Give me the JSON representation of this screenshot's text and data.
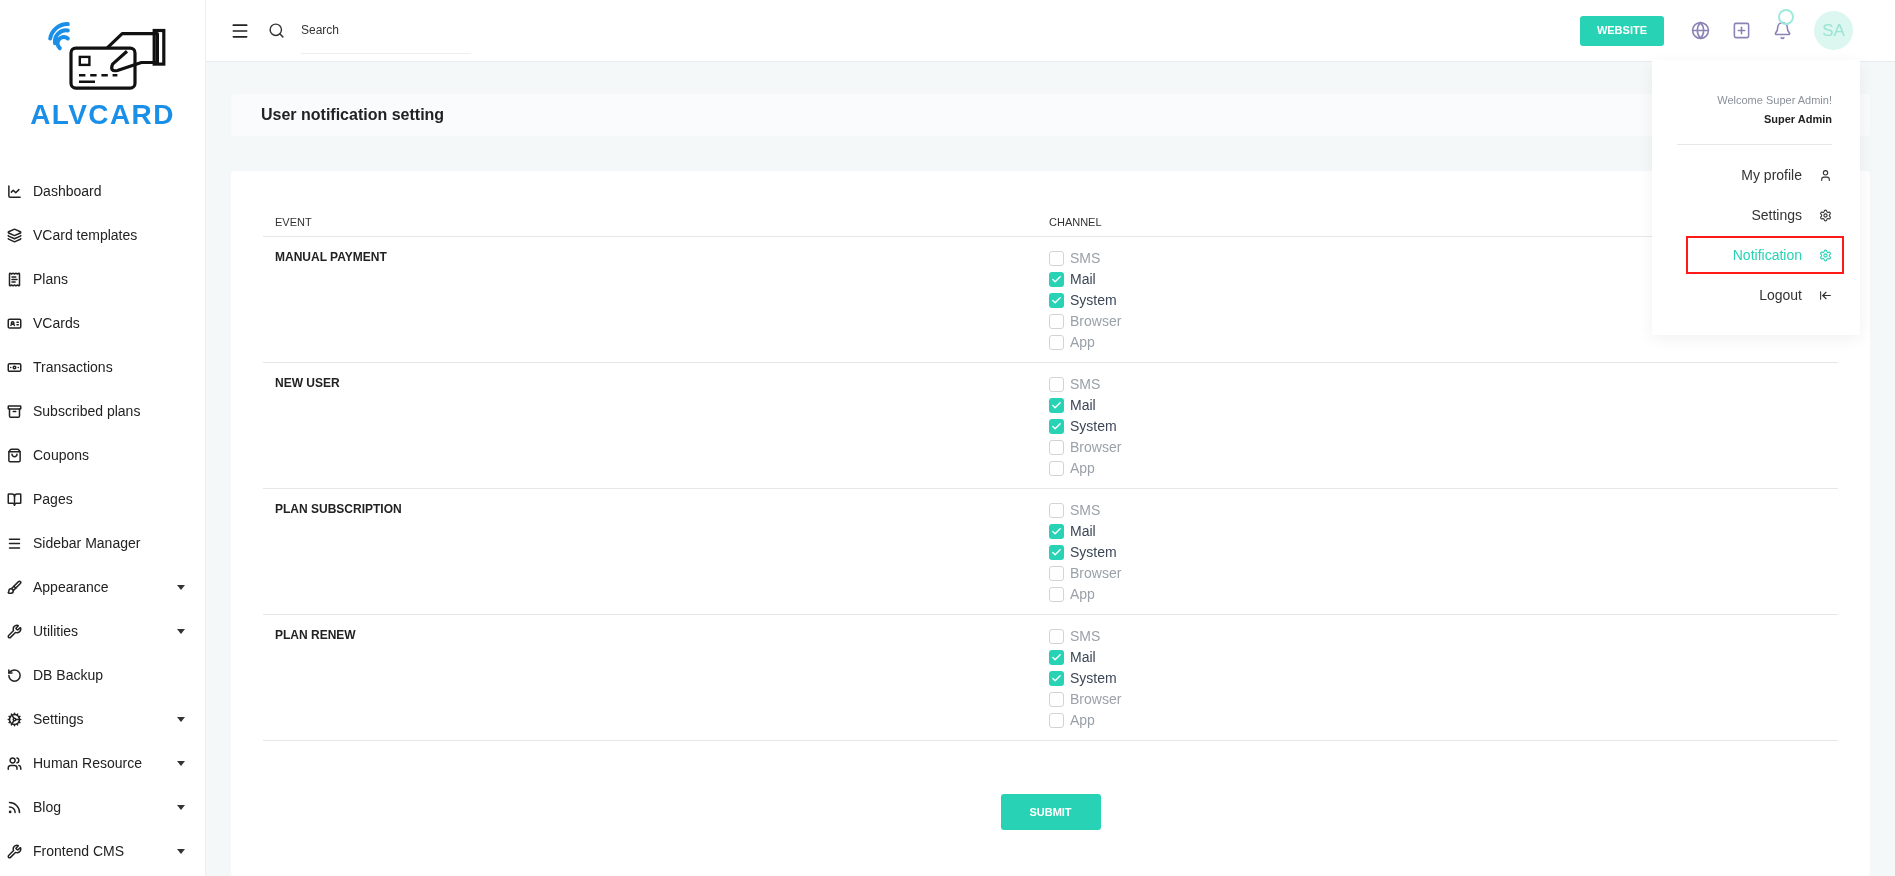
{
  "logo": {
    "text": "ALVCARD"
  },
  "sidebar": {
    "items": [
      {
        "label": "Dashboard",
        "expandable": false
      },
      {
        "label": "VCard templates",
        "expandable": false
      },
      {
        "label": "Plans",
        "expandable": false
      },
      {
        "label": "VCards",
        "expandable": false
      },
      {
        "label": "Transactions",
        "expandable": false
      },
      {
        "label": "Subscribed plans",
        "expandable": false
      },
      {
        "label": "Coupons",
        "expandable": false
      },
      {
        "label": "Pages",
        "expandable": false
      },
      {
        "label": "Sidebar Manager",
        "expandable": false
      },
      {
        "label": "Appearance",
        "expandable": true
      },
      {
        "label": "Utilities",
        "expandable": true
      },
      {
        "label": "DB Backup",
        "expandable": false
      },
      {
        "label": "Settings",
        "expandable": true
      },
      {
        "label": "Human Resource",
        "expandable": true
      },
      {
        "label": "Blog",
        "expandable": true
      },
      {
        "label": "Frontend CMS",
        "expandable": true
      }
    ]
  },
  "header": {
    "search": {
      "placeholder": "Search"
    },
    "website_button": "WEBSITE",
    "avatar": "SA"
  },
  "user_menu": {
    "welcome": "Welcome Super Admin!",
    "name": "Super Admin",
    "items": [
      {
        "label": "My profile",
        "selected": false,
        "highlighted": false
      },
      {
        "label": "Settings",
        "selected": false,
        "highlighted": false
      },
      {
        "label": "Notification",
        "selected": true,
        "highlighted": true
      },
      {
        "label": "Logout",
        "selected": false,
        "highlighted": false
      }
    ]
  },
  "page": {
    "title": "User notification setting"
  },
  "table": {
    "columns": [
      "EVENT",
      "CHANNEL"
    ],
    "rows": [
      {
        "event": "MANUAL PAYMENT",
        "channels": [
          {
            "label": "SMS",
            "checked": false
          },
          {
            "label": "Mail",
            "checked": true
          },
          {
            "label": "System",
            "checked": true
          },
          {
            "label": "Browser",
            "checked": false
          },
          {
            "label": "App",
            "checked": false
          }
        ]
      },
      {
        "event": "NEW USER",
        "channels": [
          {
            "label": "SMS",
            "checked": false
          },
          {
            "label": "Mail",
            "checked": true
          },
          {
            "label": "System",
            "checked": true
          },
          {
            "label": "Browser",
            "checked": false
          },
          {
            "label": "App",
            "checked": false
          }
        ]
      },
      {
        "event": "PLAN SUBSCRIPTION",
        "channels": [
          {
            "label": "SMS",
            "checked": false
          },
          {
            "label": "Mail",
            "checked": true
          },
          {
            "label": "System",
            "checked": true
          },
          {
            "label": "Browser",
            "checked": false
          },
          {
            "label": "App",
            "checked": false
          }
        ]
      },
      {
        "event": "PLAN RENEW",
        "channels": [
          {
            "label": "SMS",
            "checked": false
          },
          {
            "label": "Mail",
            "checked": true
          },
          {
            "label": "System",
            "checked": true
          },
          {
            "label": "Browser",
            "checked": false
          },
          {
            "label": "App",
            "checked": false
          }
        ]
      }
    ]
  },
  "submit_button": "SUBMIT"
}
